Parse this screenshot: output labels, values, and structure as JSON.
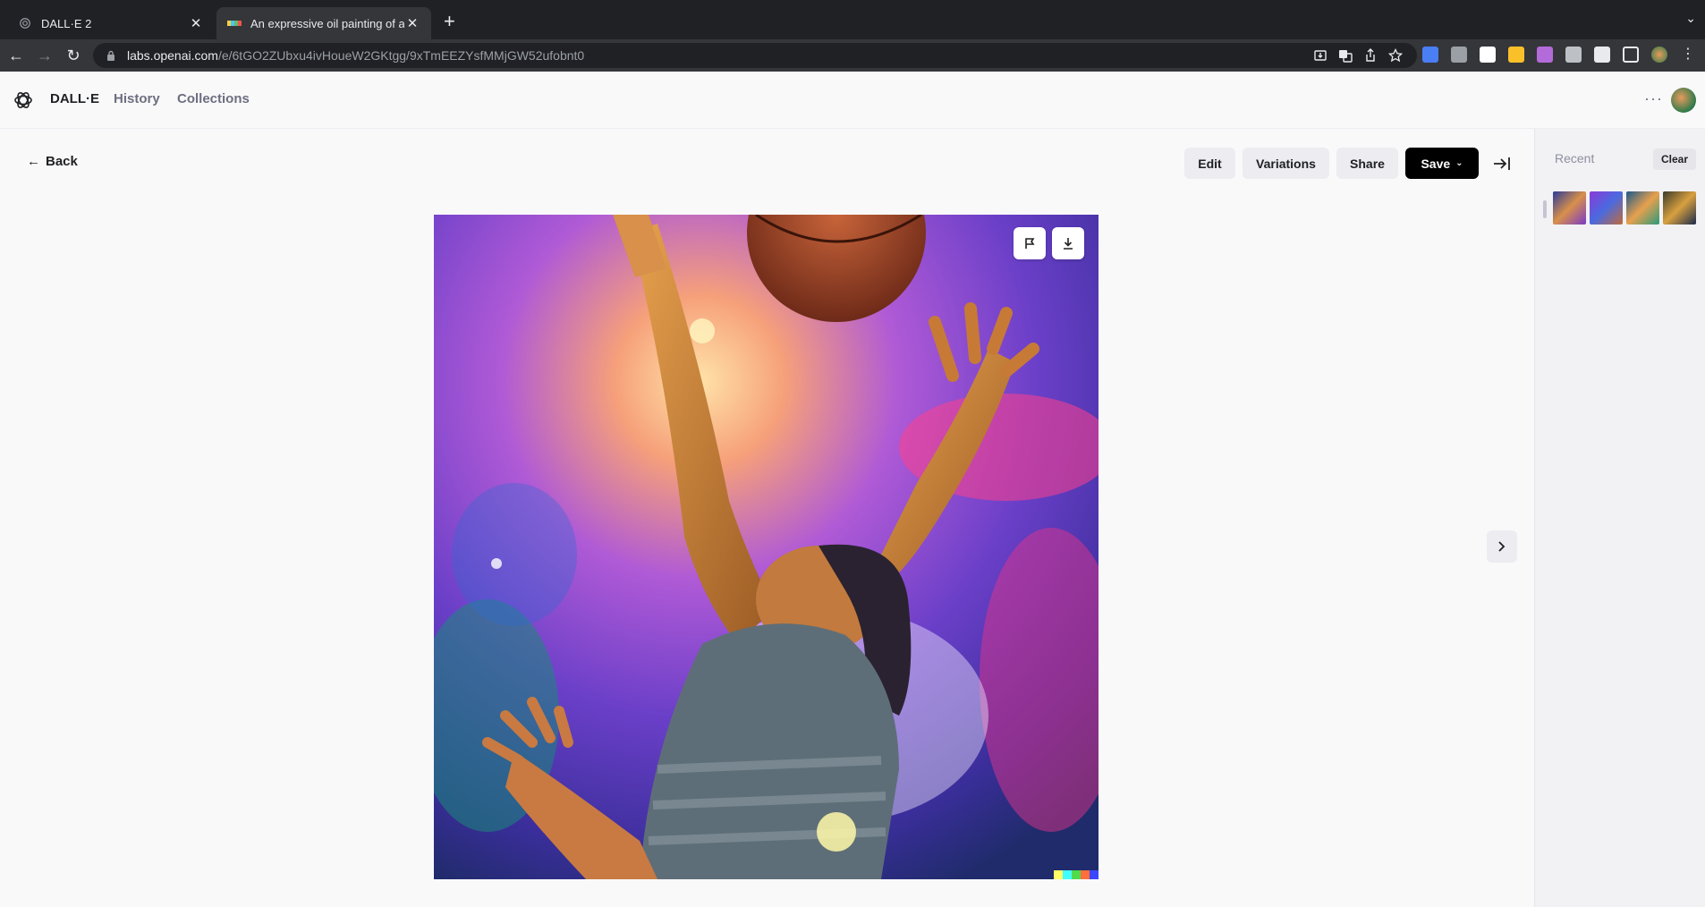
{
  "browser": {
    "tabs": [
      {
        "title": "DALL·E 2",
        "active": false
      },
      {
        "title": "An expressive oil painting of a",
        "active": true
      }
    ],
    "url_host": "labs.openai.com",
    "url_path": "/e/6tGO2ZUbxu4ivHoueW2GKtgg/9xTmEEZYsfMMjGW52ufobnt0"
  },
  "header": {
    "brand": "DALL·E",
    "nav": [
      "History",
      "Collections"
    ]
  },
  "actions": {
    "back": "Back",
    "edit": "Edit",
    "variations": "Variations",
    "share": "Share",
    "save": "Save"
  },
  "sidebar": {
    "recent_label": "Recent",
    "clear_label": "Clear"
  },
  "colors": {
    "accent": "#000000",
    "button_bg": "#ececf1",
    "page_bg": "#f9f9fa"
  }
}
